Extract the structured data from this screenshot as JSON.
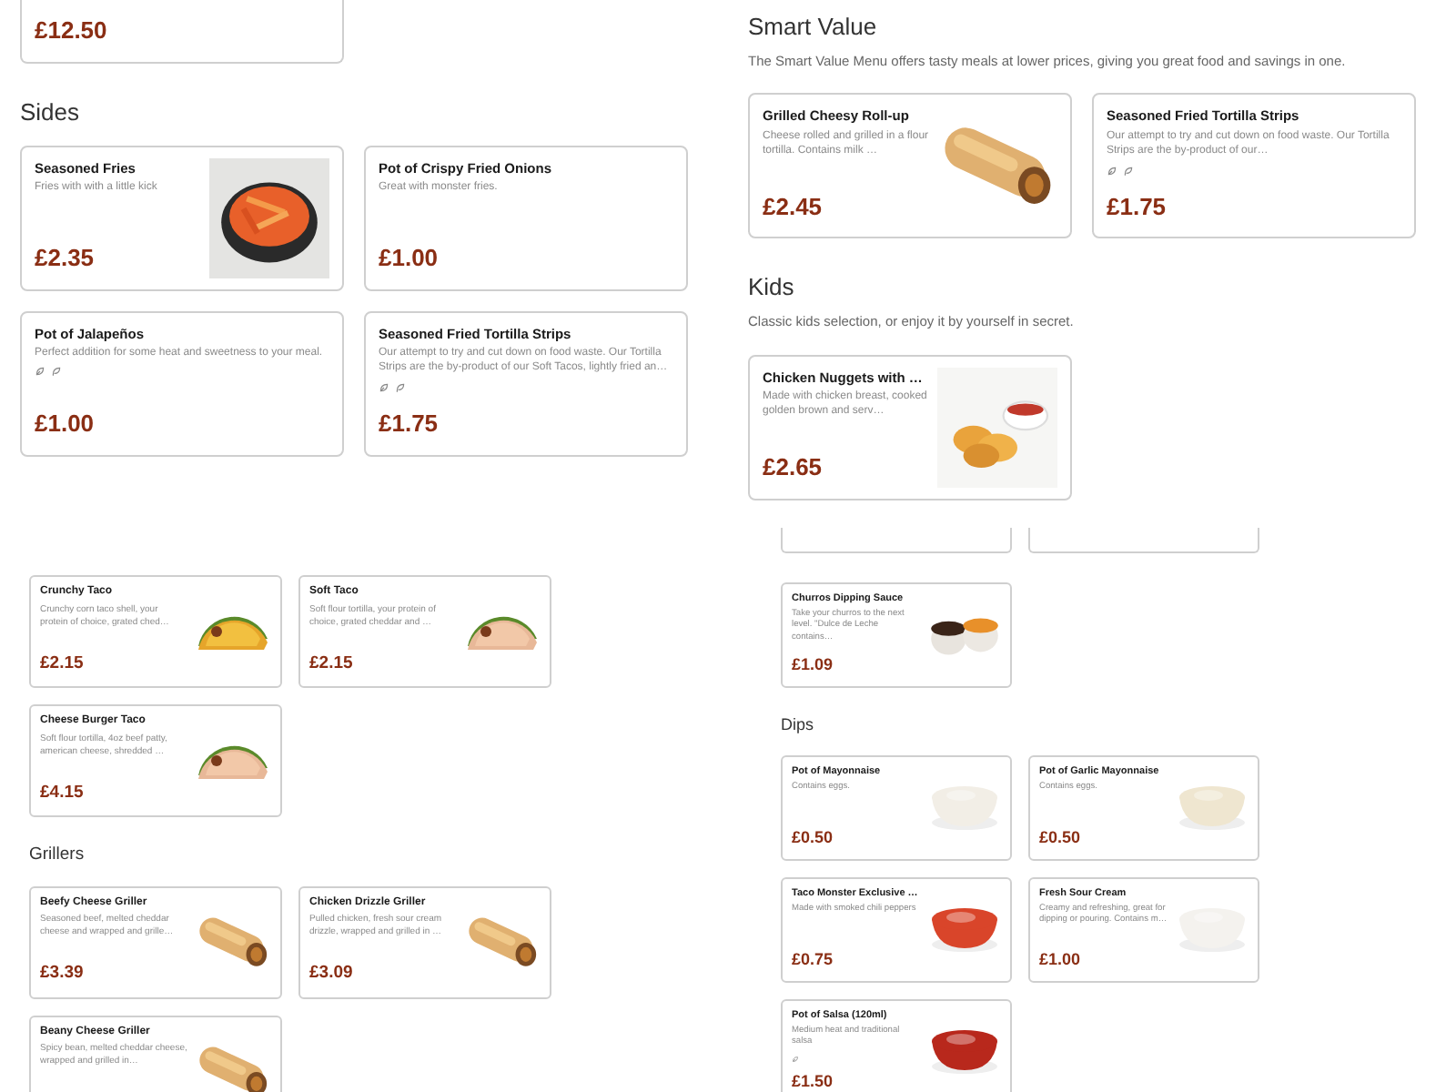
{
  "panels": [
    {
      "sections": [
        {
          "items": [
            {
              "partial": true,
              "price": "£12.50"
            }
          ]
        },
        {
          "title": "Sides",
          "items": [
            {
              "name": "Seasoned Fries",
              "description": "Fries with with a little kick",
              "price": "£2.35",
              "image": true
            },
            {
              "name": "Pot of Crispy Fried Onions",
              "description": "Great with monster fries.",
              "price": "£1.00",
              "image": false
            },
            {
              "name": "Pot of Jalapeños",
              "description": "Perfect addition for some heat and sweetness to your meal.",
              "price": "£1.00",
              "image": false,
              "marks": [
                {
                  "kind": "vegetarian"
                },
                {
                  "kind": "vegan"
                }
              ]
            },
            {
              "name": "Seasoned Fried Tortilla Strips",
              "description": "Our attempt to try and cut down on food waste. Our Tortilla Strips are the by-product of our Soft Tacos, lightly fried an…",
              "price": "£1.75",
              "image": false,
              "marks": [
                {
                  "kind": "vegetarian"
                },
                {
                  "kind": "vegan"
                }
              ]
            }
          ]
        }
      ]
    },
    {
      "sections": [
        {
          "title": "Smart Value",
          "description": "The Smart Value Menu offers tasty meals at lower prices, giving you great food and savings in one.",
          "items": [
            {
              "name": "Grilled Cheesy Roll-up",
              "description": "Cheese rolled and grilled in a flour tortilla. Contains milk …",
              "price": "£2.45",
              "image": true
            },
            {
              "name": "Seasoned Fried Tortilla Strips",
              "description": "Our attempt to try and cut down on food waste. Our Tortilla Strips are the by-product of our…",
              "price": "£1.75",
              "image": false,
              "marks": [
                {
                  "kind": "vegetarian"
                },
                {
                  "kind": "vegan"
                }
              ]
            }
          ]
        },
        {
          "title": "Kids",
          "description": "Classic kids selection, or enjoy it by yourself in secret.",
          "items": [
            {
              "name": "Chicken Nuggets with …",
              "description": "Made with chicken breast, cooked golden brown and serv…",
              "price": "£2.65",
              "image": true
            }
          ]
        }
      ]
    },
    {
      "sections": [
        {
          "items": [
            {
              "name": "Crunchy Taco",
              "description": "Crunchy corn taco shell, your protein of choice, grated ched…",
              "price": "£2.15",
              "image": true
            },
            {
              "name": "Soft Taco",
              "description": "Soft flour tortilla, your protein of choice, grated cheddar and …",
              "price": "£2.15",
              "image": true
            },
            {
              "name": "Cheese Burger Taco",
              "description": "Soft flour tortilla, 4oz beef patty, american cheese, shredded …",
              "price": "£4.15",
              "image": true
            }
          ]
        },
        {
          "title": "Grillers",
          "items": [
            {
              "name": "Beefy Cheese Griller",
              "description": "Seasoned beef, melted cheddar cheese and wrapped and grille…",
              "price": "£3.39",
              "image": true
            },
            {
              "name": "Chicken Drizzle Griller",
              "description": "Pulled chicken, fresh sour cream drizzle, wrapped and grilled in …",
              "price": "£3.09",
              "image": true
            },
            {
              "name": "Beany Cheese Griller",
              "description": "Spicy bean, melted cheddar cheese, wrapped and grilled in…",
              "image": true
            }
          ]
        }
      ]
    },
    {
      "sections": [
        {
          "items": [
            {
              "partial": true
            },
            {
              "partial": true
            }
          ]
        },
        {
          "items": [
            {
              "name": "Churros Dipping Sauce",
              "description": "Take your churros to the next level. \"Dulce de Leche contains…",
              "price": "£1.09",
              "image": true
            }
          ]
        },
        {
          "title": "Dips",
          "items": [
            {
              "name": "Pot of Mayonnaise",
              "description": "Contains eggs.",
              "price": "£0.50",
              "image": true
            },
            {
              "name": "Pot of Garlic Mayonnaise",
              "description": "Contains eggs.",
              "price": "£0.50",
              "image": true
            },
            {
              "name": "Taco Monster Exclusive …",
              "description": "Made with smoked chili peppers",
              "price": "£0.75",
              "image": true
            },
            {
              "name": "Fresh Sour Cream",
              "description": "Creamy and refreshing, great for dipping or pouring. Contains m…",
              "price": "£1.00",
              "image": true
            },
            {
              "name": "Pot of Salsa (120ml)",
              "description": "Medium heat and traditional salsa",
              "price": "£1.50",
              "image": true,
              "marks": [
                {
                  "kind": "vegetarian"
                }
              ]
            }
          ]
        }
      ]
    }
  ]
}
